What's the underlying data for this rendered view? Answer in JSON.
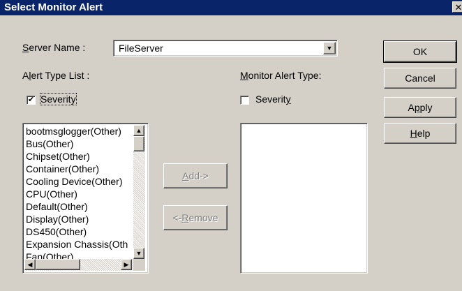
{
  "window": {
    "title": "Select Monitor Alert",
    "close_glyph": "✕"
  },
  "server": {
    "label_pre": "",
    "label_ul": "S",
    "label_post": "erver Name :",
    "value": "FileServer",
    "arrow_icon": "▼"
  },
  "alert_type_list": {
    "label_pre": "A",
    "label_ul": "l",
    "label_post": "ert Type List :",
    "severity_label": "Severity",
    "severity_check": "✔",
    "items": [
      "bootmsglogger(Other)",
      "Bus(Other)",
      "Chipset(Other)",
      "Container(Other)",
      "Cooling Device(Other)",
      "CPU(Other)",
      "Default(Other)",
      "Display(Other)",
      "DS450(Other)",
      "Expansion Chassis(Oth",
      "Fan(Other)"
    ]
  },
  "monitor_alert_type": {
    "label_pre": "",
    "label_ul": "M",
    "label_post": "onitor Alert Type:",
    "severity_pre": "Severit",
    "severity_ul": "y"
  },
  "buttons": {
    "ok": "OK",
    "cancel": "Cancel",
    "apply_pre": "A",
    "apply_ul": "p",
    "apply_post": "ply",
    "help_pre": "",
    "help_ul": "H",
    "help_post": "elp",
    "add_pre": "",
    "add_ul": "A",
    "add_post": "dd->",
    "remove_pre": "<-",
    "remove_ul": "R",
    "remove_post": "emove"
  },
  "scroll_icons": {
    "up": "▲",
    "down": "▼",
    "left": "◀",
    "right": "▶"
  }
}
